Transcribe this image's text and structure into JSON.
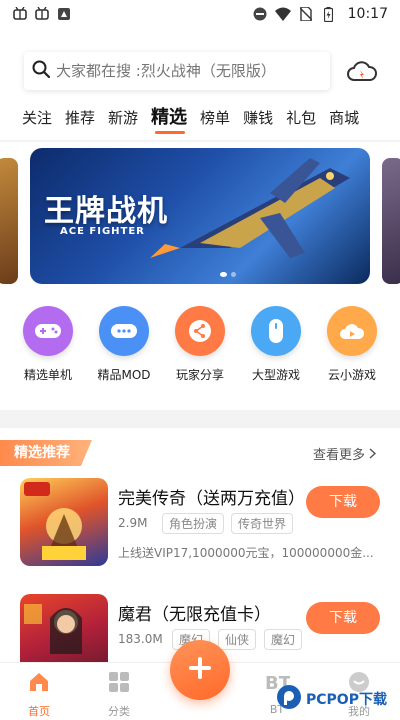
{
  "status_bar": {
    "time": "10:17",
    "left_icons": [
      "bug-icon",
      "bug-icon",
      "notification-icon"
    ],
    "right_icons": [
      "dnd-icon",
      "wifi-icon",
      "no-sim-icon",
      "battery-icon"
    ]
  },
  "search": {
    "placeholder": "大家都在搜 :烈火战神（无限版）"
  },
  "tabs": [
    {
      "label": "关注"
    },
    {
      "label": "推荐"
    },
    {
      "label": "新游"
    },
    {
      "label": "精选",
      "active": true
    },
    {
      "label": "榜单"
    },
    {
      "label": "赚钱"
    },
    {
      "label": "礼包"
    },
    {
      "label": "商城"
    }
  ],
  "banner": {
    "title": "王牌战机",
    "subtitle": "ACE FIGHTER"
  },
  "categories": [
    {
      "label": "精选单机",
      "icon": "gamepad-icon",
      "color": "#b36cf0"
    },
    {
      "label": "精品MOD",
      "icon": "controller-icon",
      "color": "#4a90f5"
    },
    {
      "label": "玩家分享",
      "icon": "share-icon",
      "color": "#ff7a45"
    },
    {
      "label": "大型游戏",
      "icon": "mouse-icon",
      "color": "#4aa8f5"
    },
    {
      "label": "云小游戏",
      "icon": "cloud-game-icon",
      "color": "#ffa94a"
    }
  ],
  "recommended": {
    "section_label": "精选推荐",
    "more_label": "查看更多",
    "games": [
      {
        "name": "完美传奇（送两万充值）",
        "size": "2.9M",
        "tags": [
          "角色扮演",
          "传奇世界"
        ],
        "desc": "上线送VIP17,1000000元宝，100000000金...",
        "button": "下载"
      },
      {
        "name": "魔君（无限充值卡）",
        "size": "183.0M",
        "tags": [
          "魔幻",
          "仙侠",
          "魔幻"
        ],
        "desc": "",
        "button": "下载"
      }
    ]
  },
  "nav": {
    "home": "首页",
    "category": "分类",
    "bt": "BT",
    "mine": "我的"
  },
  "watermark": "PCPOP下载",
  "colors": {
    "accent": "#ff6a2a",
    "button": "#ff7a45"
  }
}
